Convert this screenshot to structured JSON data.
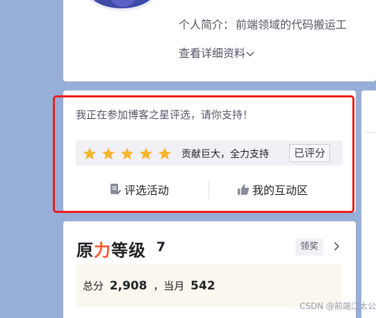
{
  "profile": {
    "bio_label": "个人简介：",
    "bio_text": "前端领域的代码搬运工",
    "more_link": "查看详细资料"
  },
  "star_event": {
    "title": "我正在参加博客之星评选，请你支持！",
    "rating_stars": 5,
    "rating_text": "贡献巨大，全力支持",
    "rated_label": "已评分",
    "action_vote": "评选活动",
    "action_interact": "我的互动区",
    "colors": {
      "star": "#f6b72d",
      "highlight": "#ee1c1c"
    }
  },
  "level": {
    "logo_part1": "原",
    "logo_accent": "力",
    "logo_part2": "等级",
    "value": "7",
    "claim_button": "领奖",
    "stats_total_label": "总分",
    "stats_total_value": "2,908",
    "stats_month_label": "，当月",
    "stats_month_value": "542",
    "colors": {
      "accent": "#fc5531"
    }
  },
  "watermark": "CSDN @前端江太公"
}
